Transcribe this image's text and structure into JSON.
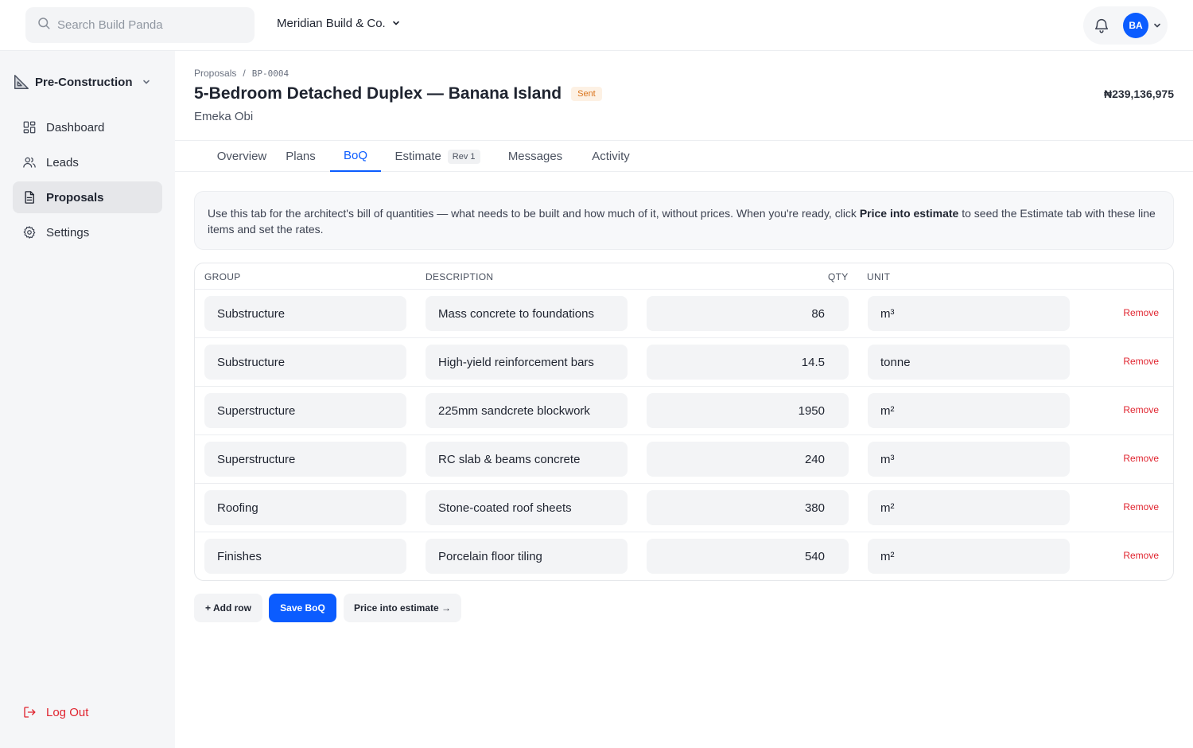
{
  "search": {
    "placeholder": "Search Build Panda"
  },
  "org": {
    "name": "Meridian Build & Co."
  },
  "user": {
    "initials": "BA"
  },
  "sidebar": {
    "workspace": "Pre-Construction",
    "items": [
      {
        "label": "Dashboard",
        "icon": "grid-icon"
      },
      {
        "label": "Leads",
        "icon": "users-icon"
      },
      {
        "label": "Proposals",
        "icon": "document-icon",
        "active": true
      },
      {
        "label": "Settings",
        "icon": "gear-icon"
      }
    ],
    "logout": "Log Out"
  },
  "breadcrumb": {
    "parent": "Proposals",
    "separator": "/",
    "current": "BP-0004"
  },
  "proposal": {
    "title": "5-Bedroom Detached Duplex — Banana Island",
    "status": "Sent",
    "client": "Emeka Obi",
    "total": "₦239,136,975"
  },
  "tabs": {
    "overview": "Overview",
    "plans": "Plans",
    "boq": "BoQ",
    "estimate": "Estimate",
    "estimate_rev": "Rev 1",
    "messages": "Messages",
    "activity": "Activity",
    "active": "BoQ"
  },
  "info": {
    "text_before": "Use this tab for the architect's bill of quantities — what needs to be built and how much of it, without prices. When you're ready, click ",
    "highlight": "Price into estimate",
    "text_after": " to seed the Estimate tab with these line items and set the rates."
  },
  "table": {
    "headers": {
      "group": "GROUP",
      "description": "DESCRIPTION",
      "qty": "QTY",
      "unit": "UNIT"
    },
    "remove_label": "Remove",
    "rows": [
      {
        "group": "Substructure",
        "description": "Mass concrete to foundations",
        "qty": "86",
        "unit": "m³"
      },
      {
        "group": "Substructure",
        "description": "High-yield reinforcement bars",
        "qty": "14.5",
        "unit": "tonne"
      },
      {
        "group": "Superstructure",
        "description": "225mm sandcrete blockwork",
        "qty": "1950",
        "unit": "m²"
      },
      {
        "group": "Superstructure",
        "description": "RC slab & beams concrete",
        "qty": "240",
        "unit": "m³"
      },
      {
        "group": "Roofing",
        "description": "Stone-coated roof sheets",
        "qty": "380",
        "unit": "m²"
      },
      {
        "group": "Finishes",
        "description": "Porcelain floor tiling",
        "qty": "540",
        "unit": "m²"
      }
    ]
  },
  "actions": {
    "add_row": "+ Add row",
    "save": "Save BoQ",
    "price_into_estimate": "Price into estimate →"
  },
  "colors": {
    "accent": "#0b5cff",
    "danger": "#e0242f",
    "status_sent": "#d9731a"
  }
}
